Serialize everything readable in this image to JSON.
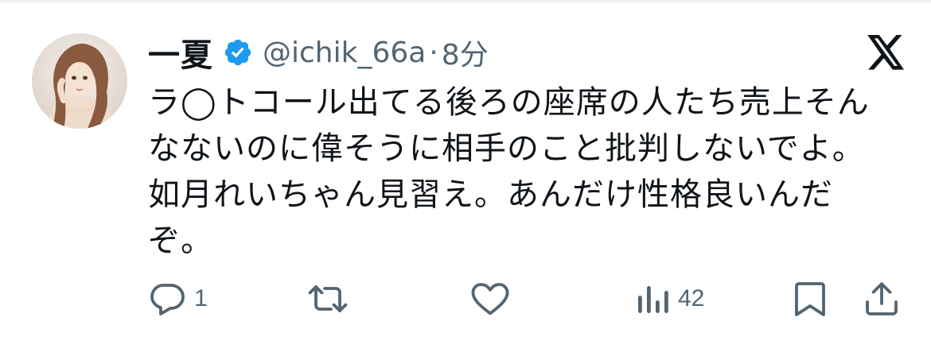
{
  "tweet": {
    "author_name": "一夏",
    "handle": "@ichik_66a",
    "separator": "·",
    "time": "8分",
    "verified": true,
    "text": "ラ◯トコール出てる後ろの座席の人たち売上そんなないのに偉そうに相手のこと批判しないでよ。如月れいちゃん見習え。あんだけ性格良いんだぞ。"
  },
  "metrics": {
    "replies": "1",
    "reposts": "",
    "likes": "",
    "views": "42"
  },
  "icons": {
    "verified": "verified-badge-icon",
    "x_logo": "x-logo-icon",
    "reply": "reply-icon",
    "repost": "repost-icon",
    "like": "heart-icon",
    "views": "views-chart-icon",
    "bookmark": "bookmark-icon",
    "share": "share-icon"
  },
  "colors": {
    "verified": "#1d9bf0",
    "muted": "#536471",
    "text": "#0f1419"
  }
}
